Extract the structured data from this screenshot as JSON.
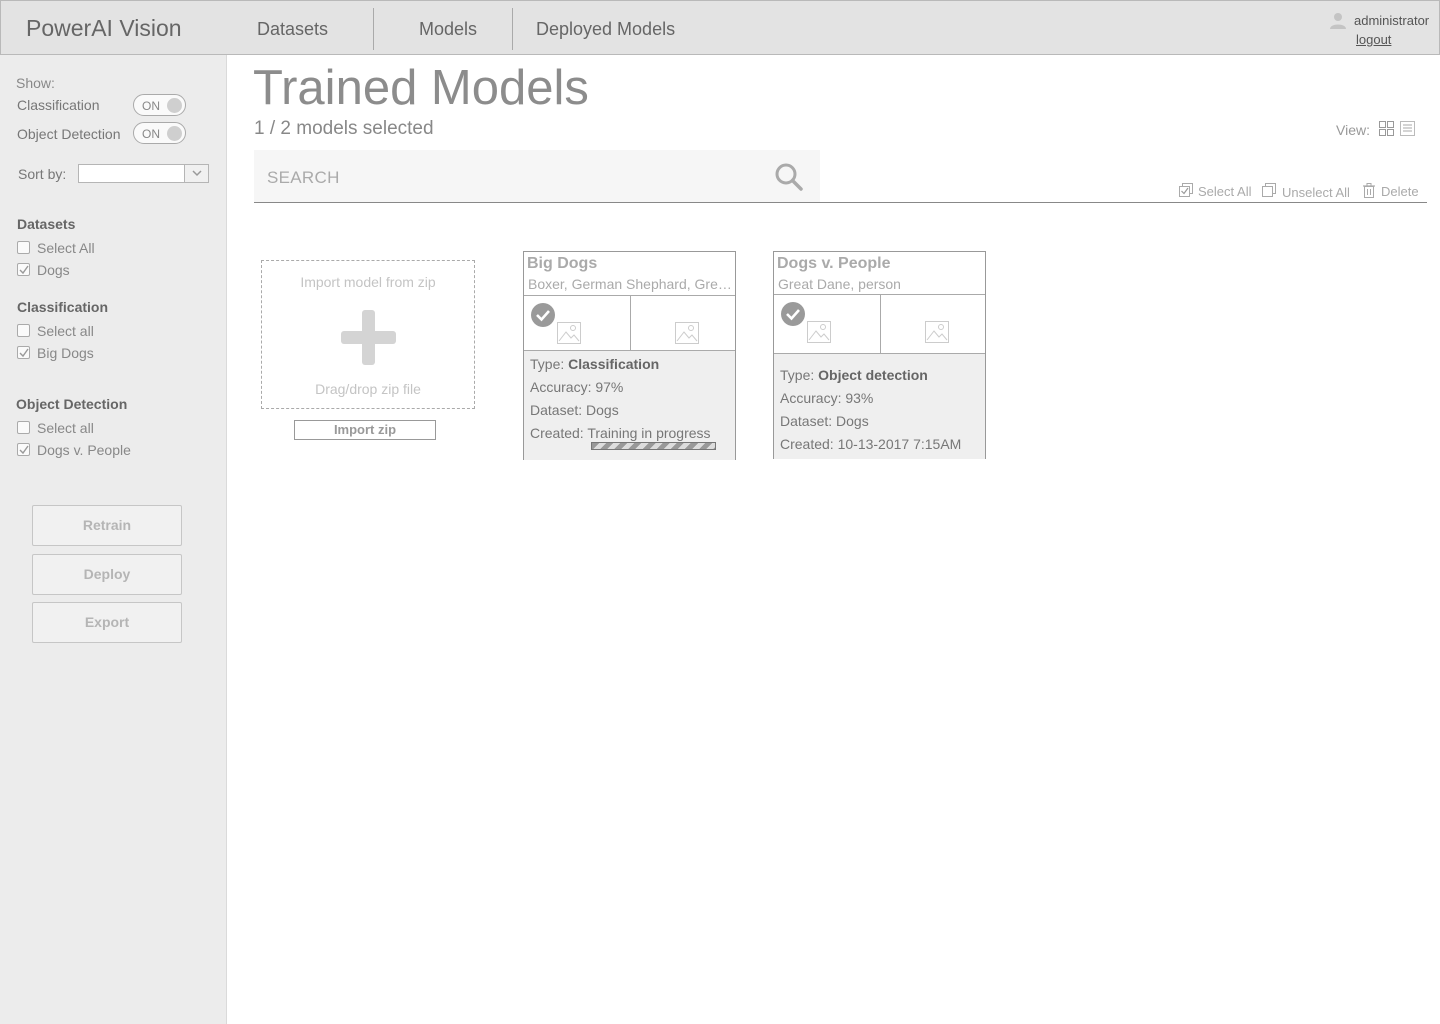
{
  "header": {
    "brand": "PowerAI Vision",
    "nav": [
      "Datasets",
      "Models",
      "Deployed Models"
    ],
    "user": "administrator",
    "logout": "logout"
  },
  "sidebar": {
    "show_label": "Show:",
    "toggles": [
      {
        "label": "Classification",
        "state": "ON"
      },
      {
        "label": "Object Detection",
        "state": "ON"
      }
    ],
    "sort_label": "Sort by:",
    "sort_value": "",
    "groups": [
      {
        "heading": "Datasets",
        "items": [
          {
            "label": "Select All",
            "checked": false
          },
          {
            "label": "Dogs",
            "checked": true
          }
        ]
      },
      {
        "heading": "Classification",
        "items": [
          {
            "label": "Select all",
            "checked": false
          },
          {
            "label": "Big Dogs",
            "checked": true
          }
        ]
      },
      {
        "heading": "Object Detection",
        "items": [
          {
            "label": "Select all",
            "checked": false
          },
          {
            "label": "Dogs v. People",
            "checked": true
          }
        ]
      }
    ],
    "buttons": [
      "Retrain",
      "Deploy",
      "Export"
    ]
  },
  "main": {
    "title": "Trained Models",
    "selection_status": "1 / 2 models selected",
    "view_label": "View:",
    "search_placeholder": "SEARCH",
    "actions": {
      "select_all": "Select All",
      "unselect_all": "Unselect All",
      "delete": "Delete"
    },
    "import": {
      "heading": "Import model from zip",
      "drop_hint": "Drag/drop zip file",
      "button": "Import zip"
    },
    "cards": [
      {
        "name": "Big Dogs",
        "tags": "Boxer, German Shephard, Great Dane",
        "selected": true,
        "type_label": "Type:",
        "type": "Classification",
        "accuracy": "Accuracy: 97%",
        "dataset": "Dataset: Dogs",
        "created": "Created: Training in progress",
        "training_in_progress": true
      },
      {
        "name": "Dogs v. People",
        "tags": "Great Dane, person",
        "selected": true,
        "type_label": "Type:",
        "type": "Object detection",
        "accuracy": "Accuracy: 93%",
        "dataset": "Dataset: Dogs",
        "created": "Created: 10-13-2017 7:15AM",
        "training_in_progress": false
      }
    ]
  },
  "icons": {
    "user": "user-icon",
    "chevron": "chevron-down-icon",
    "search": "search-icon",
    "grid_view": "grid-view-icon",
    "list_view": "list-view-icon",
    "select_all": "select-all-icon",
    "unselect_all": "unselect-all-icon",
    "delete": "trash-icon",
    "plus": "plus-icon",
    "image": "image-placeholder-icon",
    "check": "check-circle-icon"
  }
}
